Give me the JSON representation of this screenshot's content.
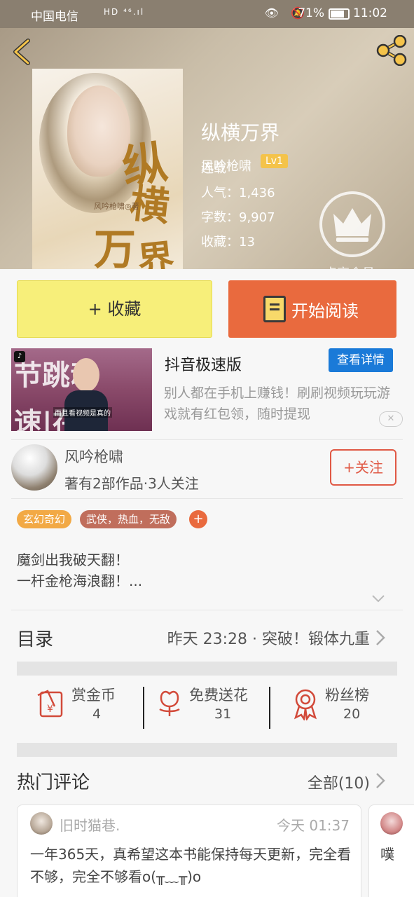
{
  "status_bar": {
    "carrier": "中国电信",
    "network": "HD ⁴⁶.ıl",
    "battery": "71%",
    "time": "11:02"
  },
  "book": {
    "title": "纵横万界",
    "author": "风吟枪啸",
    "level": "Lv1",
    "status": "连载",
    "popularity": "人气：1,436",
    "word_count": "字数：9,907",
    "favorites": "收藏：13",
    "member_label": "点亮会员",
    "cover_chars": [
      "纵",
      "横",
      "万",
      "界"
    ],
    "cover_author": "风吟枪啸◎著"
  },
  "actions": {
    "collect": "+ 收藏",
    "read": "开始阅读"
  },
  "ad": {
    "title": "抖音极速版",
    "detail_button": "查看详情",
    "description": "别人都在手机上赚钱！刷刷视频玩玩游戏就有红包领，随时提现",
    "image_caption": "而且看视频是真的",
    "image_text_top": "节跳动",
    "image_text_bottom": "速|在",
    "close": "✕"
  },
  "author_section": {
    "name": "风吟枪啸",
    "stats": "著有2部作品·3人关注",
    "follow_button": "+关注"
  },
  "tags": [
    "玄幻奇幻",
    "武侠，热血，无敌"
  ],
  "tag_add": "+",
  "synopsis": [
    "魔剑出我破天翻！",
    "一杆金枪海浪翻！..."
  ],
  "catalog": {
    "title": "目录",
    "latest": "昨天 23:28 · 突破！锻体九重"
  },
  "rewards": [
    {
      "label": "赏金币",
      "count": "4"
    },
    {
      "label": "免费送花",
      "count": "31"
    },
    {
      "label": "粉丝榜",
      "count": "20"
    }
  ],
  "comments_section": {
    "title": "热门评论",
    "all": "全部(10)"
  },
  "comments": [
    {
      "user": "旧时猫巷.",
      "time": "今天 01:37",
      "text": "一年365天，真希望这本书能保持每天更新，完全看不够，完全不够看o(╥﹏╥)o"
    },
    {
      "text": "噗"
    }
  ],
  "colors": {
    "accent": "#e96a3e",
    "collect_bg": "#f7ef7a",
    "level_badge": "#f4c34a",
    "ad_button": "#1a7ad8"
  }
}
